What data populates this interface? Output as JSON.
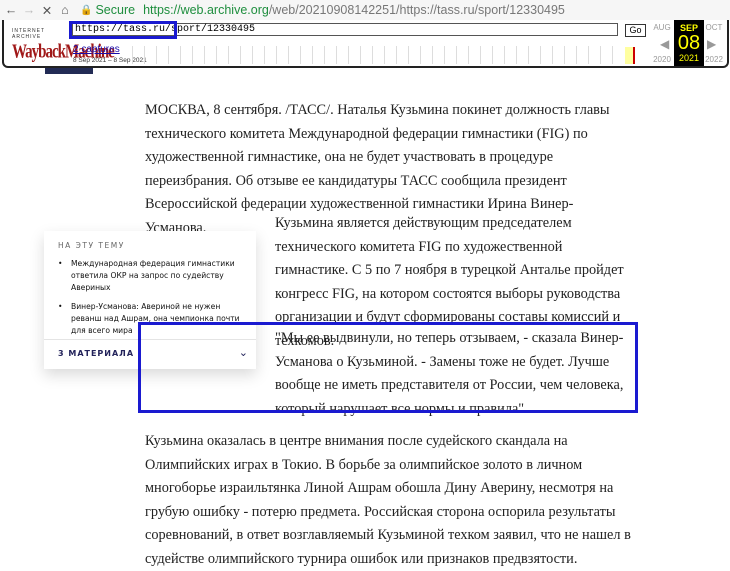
{
  "browser": {
    "url_host": "https://web.archive.org",
    "url_path": "/web/20210908142251/https://tass.ru/sport/12330495",
    "secure": "Secure"
  },
  "wayback": {
    "logo_top": "INTERNET ARCHIVE",
    "logo": "WaybackMachine",
    "url": "https://tass.ru/sport/12330495",
    "go": "Go",
    "captures": "2 captures",
    "range": "8 Sep 2021 – 8 Sep 2021",
    "prev_month": "AUG",
    "month": "SEP",
    "next_month": "OCT",
    "day": "08",
    "prev_year": "2020",
    "year": "2021",
    "next_year": "2022"
  },
  "article": {
    "p1": "МОСКВА, 8 сентября. /ТАСС/. Наталья Кузьмина покинет должность главы технического комитета Международной федерации гимнастики (FIG) по художественной гимнастике, она не будет участвовать в процедуре переизбрания. Об отзыве ее кандидатуры ТАСС сообщила президент Всероссийской федерации художественной гимнастики Ирина Винер-Усманова.",
    "p2": "Кузьмина является действующим председателем технического комитета FIG по художественной гимнастике. С 5 по 7 ноября в турецкой Анталье пройдет конгресс FIG, на котором состоятся выборы руководства организации и будут сформированы составы комиссий и техкомов.",
    "p3": "\"Мы ее выдвинули, но теперь отзываем, - сказала Винер-Усманова о Кузьминой. - Замены тоже не будет. Лучше вообще не иметь представителя от России, чем человека, который нарушает все нормы и правила\".",
    "p4": "Кузьмина оказалась в центре внимания после судейского скандала на Олимпийских играх в Токио. В борьбе за олимпийское золото в личном многоборье израильтянка Линой Ашрам обошла Дину Аверину, несмотря на грубую ошибку - потерю предмета. Российская сторона оспорила результаты соревнований, в ответ возглавляемый Кузьминой техком заявил, что не нашел в судействе олимпийского турнира ошибок или признаков предвзятости."
  },
  "related": {
    "title": "НА ЭТУ ТЕМУ",
    "items": [
      "Международная федерация гимнастики ответила ОКР на запрос по судейству Авериных",
      "Винер-Усманова: Авериной не нужен реванш над Ашрам, она чемпионка почти для всего мира"
    ],
    "more": "3 МАТЕРИАЛА"
  }
}
